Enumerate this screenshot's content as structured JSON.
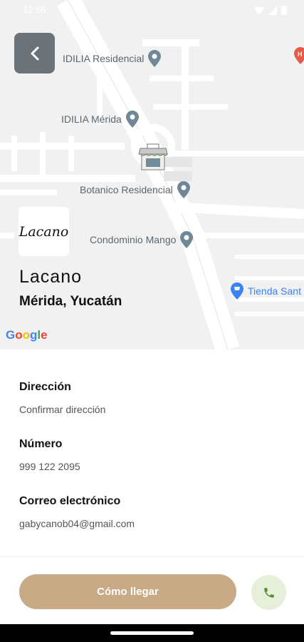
{
  "status_bar": {
    "time": "12:56"
  },
  "header": {
    "back_icon": "chevron-left-icon"
  },
  "map": {
    "pois": [
      {
        "label": "IDILIA Residencial"
      },
      {
        "label": "IDILIA Mérida"
      },
      {
        "label": "Botanico Residencial"
      },
      {
        "label": "Condominio Mango"
      },
      {
        "label": "Tienda Sant"
      }
    ],
    "attribution": [
      "G",
      "o",
      "o",
      "g",
      "l",
      "e"
    ]
  },
  "store": {
    "logo_text": "Lacano",
    "name": "Lacano",
    "city": "Mérida, Yucatán"
  },
  "details": {
    "address_label": "Dirección",
    "address_value": "Confirmar dirección",
    "phone_label": "Número",
    "phone_value": "999 122 2095",
    "email_label": "Correo electrónico",
    "email_value": "gabycanob04@gmail.com"
  },
  "actions": {
    "directions_label": "Cómo llegar",
    "call_icon": "phone-icon"
  },
  "colors": {
    "primary": "#c8aa86",
    "call_bg": "#e6efd9",
    "call_icon": "#5a8a3a",
    "back_bg": "#6c7378",
    "pin": "#6f8796",
    "store_pin": "#3b82f6"
  }
}
